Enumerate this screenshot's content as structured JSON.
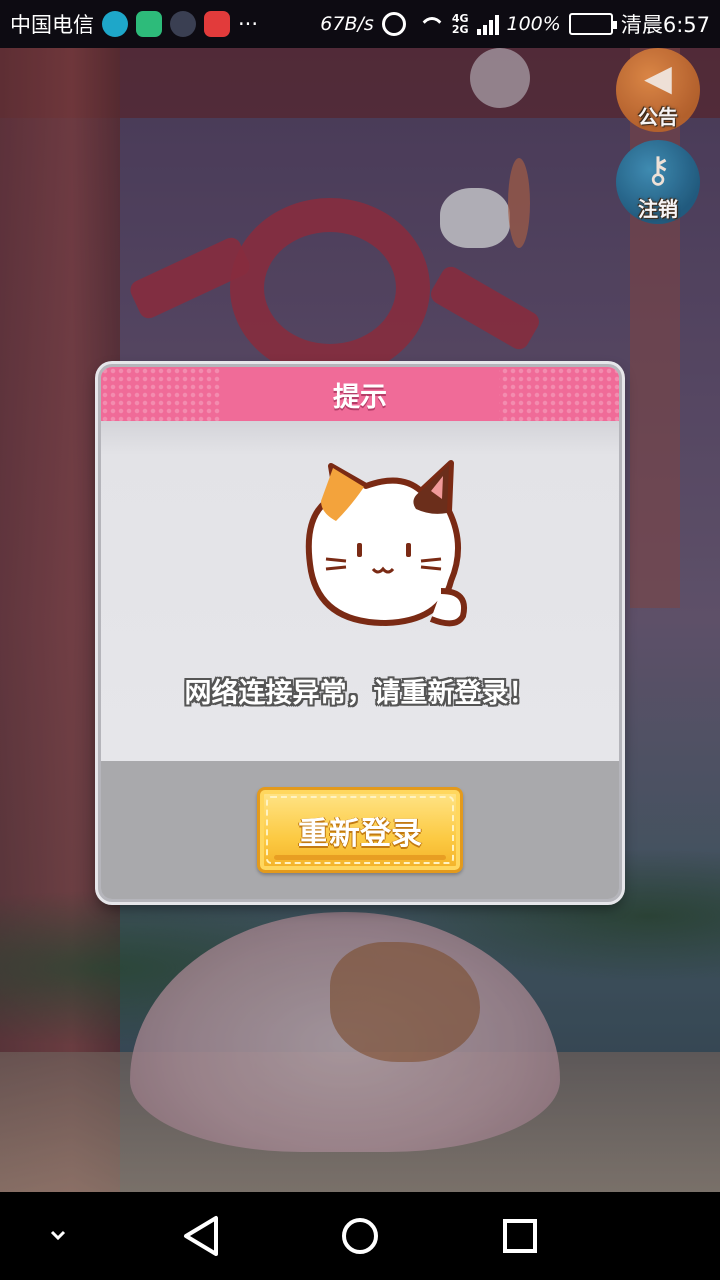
{
  "status_bar": {
    "carrier": "中国电信",
    "more": "···",
    "speed": "67B/s",
    "network_top": "4G",
    "network_bottom": "2G",
    "battery": "100%",
    "time": "清晨6:57"
  },
  "side_buttons": {
    "notice_label": "公告",
    "logout_label": "注销"
  },
  "dialog": {
    "title": "提示",
    "message": "网络连接异常，请重新登录！",
    "button_label": "重新登录"
  },
  "colors": {
    "header_pink": "#f06b98",
    "button_yellow": "#fcca43",
    "dialog_gray": "#cfcfd3"
  }
}
